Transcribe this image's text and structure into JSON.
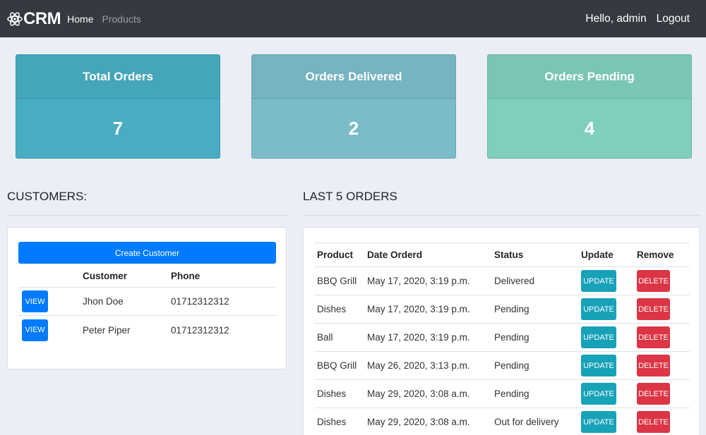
{
  "navbar": {
    "brand": "CRM",
    "brand_icon": "atom-icon",
    "links": [
      "Home",
      "Products"
    ],
    "greeting": "Hello, admin",
    "logout": "Logout",
    "background": "#343a40"
  },
  "stats": [
    {
      "title": "Total Orders",
      "value": "7",
      "color": "#48adc2"
    },
    {
      "title": "Orders Delivered",
      "value": "2",
      "color": "#7abcc8"
    },
    {
      "title": "Orders Pending",
      "value": "4",
      "color": "#7fcfbc"
    }
  ],
  "customers": {
    "title": "CUSTOMERS:",
    "create_label": "Create Customer",
    "columns": [
      "",
      "Customer",
      "Phone"
    ],
    "rows": [
      {
        "action": "VIEW",
        "name": "Jhon Doe",
        "phone": "01712312312"
      },
      {
        "action": "VIEW",
        "name": "Peter Piper",
        "phone": "01712312312"
      }
    ]
  },
  "orders": {
    "title": "LAST 5 ORDERS",
    "columns": [
      "Product",
      "Date Orderd",
      "Status",
      "Update",
      "Remove"
    ],
    "update_label": "UPDATE",
    "delete_label": "DELETE",
    "rows": [
      {
        "product": "BBQ Grill",
        "date": "May 17, 2020, 3:19 p.m.",
        "status": "Delivered"
      },
      {
        "product": "Dishes",
        "date": "May 17, 2020, 3:19 p.m.",
        "status": "Pending"
      },
      {
        "product": "Ball",
        "date": "May 17, 2020, 3:19 p.m.",
        "status": "Pending"
      },
      {
        "product": "BBQ Grill",
        "date": "May 26, 2020, 3:13 p.m.",
        "status": "Pending"
      },
      {
        "product": "Dishes",
        "date": "May 29, 2020, 3:08 a.m.",
        "status": "Pending"
      },
      {
        "product": "Dishes",
        "date": "May 29, 2020, 3:08 a.m.",
        "status": "Out for delivery"
      }
    ]
  },
  "colors": {
    "primary": "#007bff",
    "info": "#17a2b8",
    "danger": "#dc3545",
    "page_bg": "#ebeef5"
  }
}
